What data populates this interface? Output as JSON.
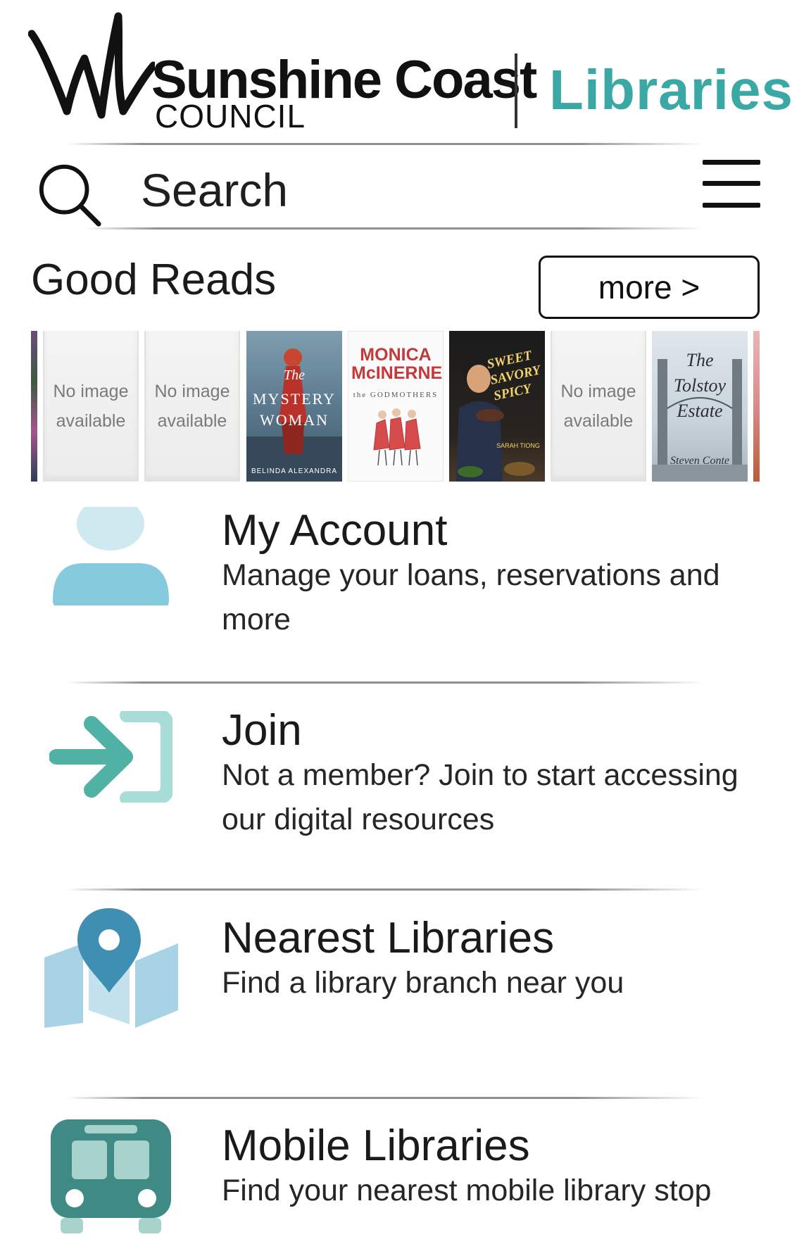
{
  "header": {
    "brand_name": "Sunshine Coast",
    "brand_tm": "™",
    "brand_sub": "COUNCIL",
    "product": "Libraries",
    "accent_color": "#3aa8a4"
  },
  "search": {
    "label": "Search",
    "icon": "search-icon"
  },
  "menu": {
    "icon": "hamburger-menu-icon"
  },
  "good_reads": {
    "title": "Good Reads",
    "more_label": "more >",
    "covers": [
      {
        "type": "partial-edge"
      },
      {
        "type": "placeholder",
        "text": "No image available"
      },
      {
        "type": "placeholder",
        "text": "No image available"
      },
      {
        "type": "book",
        "title_top": "The",
        "title": "MYSTERY WOMAN",
        "author": "BELINDA ALEXANDRA"
      },
      {
        "type": "book",
        "author": "MONICA McINERNEY",
        "title": "the GODMOTHERS"
      },
      {
        "type": "book",
        "title": "SWEET SAVORY SPICY",
        "author": "SARAH TIONG"
      },
      {
        "type": "placeholder",
        "text": "No image available"
      },
      {
        "type": "book",
        "title": "The Tolstoy Estate",
        "author": "Steven Conte"
      },
      {
        "type": "partial-edge"
      }
    ],
    "placeholder_text": "No image available"
  },
  "items": [
    {
      "title": "My Account",
      "desc": "Manage your loans, reservations and more",
      "icon": "person-icon"
    },
    {
      "title": "Join",
      "desc": "Not a member? Join to start accessing our digital resources",
      "icon": "join-arrow-icon"
    },
    {
      "title": "Nearest Libraries",
      "desc": "Find a library branch near you",
      "icon": "map-pin-icon"
    },
    {
      "title": "Mobile Libraries",
      "desc": "Find your nearest mobile library stop",
      "icon": "bus-icon"
    }
  ]
}
